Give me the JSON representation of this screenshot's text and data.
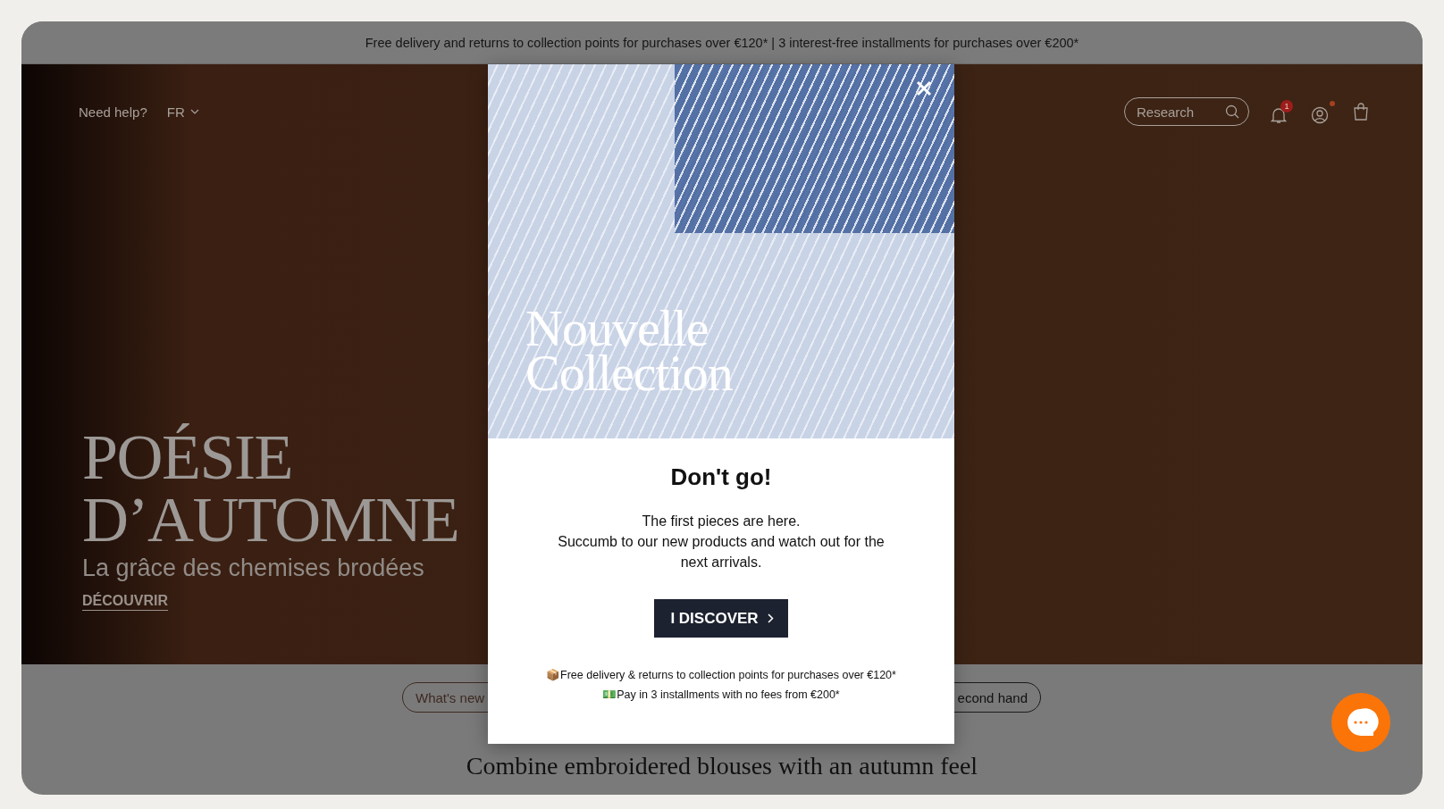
{
  "announcement_bar": {
    "text": "Free delivery and returns to collection points for purchases over €120* | 3 interest-free installments for purchases over €200*"
  },
  "header": {
    "help_link": "Need help?",
    "language": "FR",
    "search": {
      "placeholder": "Research"
    },
    "notification_count": "1",
    "account_alert": true
  },
  "hero": {
    "title_lines": [
      "POÉSIE",
      "D’AUTOMNE"
    ],
    "subtitle": "La grâce des chemises brodées",
    "link": "DÉCOUVRIR"
  },
  "category_pills": [
    {
      "label": "What's new"
    },
    {
      "label": "econd hand"
    }
  ],
  "section_heading": "Combine embroidered blouses with an autumn feel",
  "popup": {
    "image_caption_lines": [
      "Nouvelle",
      "Collection"
    ],
    "title": "Don't go!",
    "body_lines": [
      "The first pieces are here.",
      "Succumb to our new products and watch out for the next arrivals."
    ],
    "button": "I DISCOVER",
    "perks": [
      "📦Free delivery & returns to collection points for purchases over €120*",
      "💵Pay in 3 installments with no fees from €200*"
    ]
  }
}
